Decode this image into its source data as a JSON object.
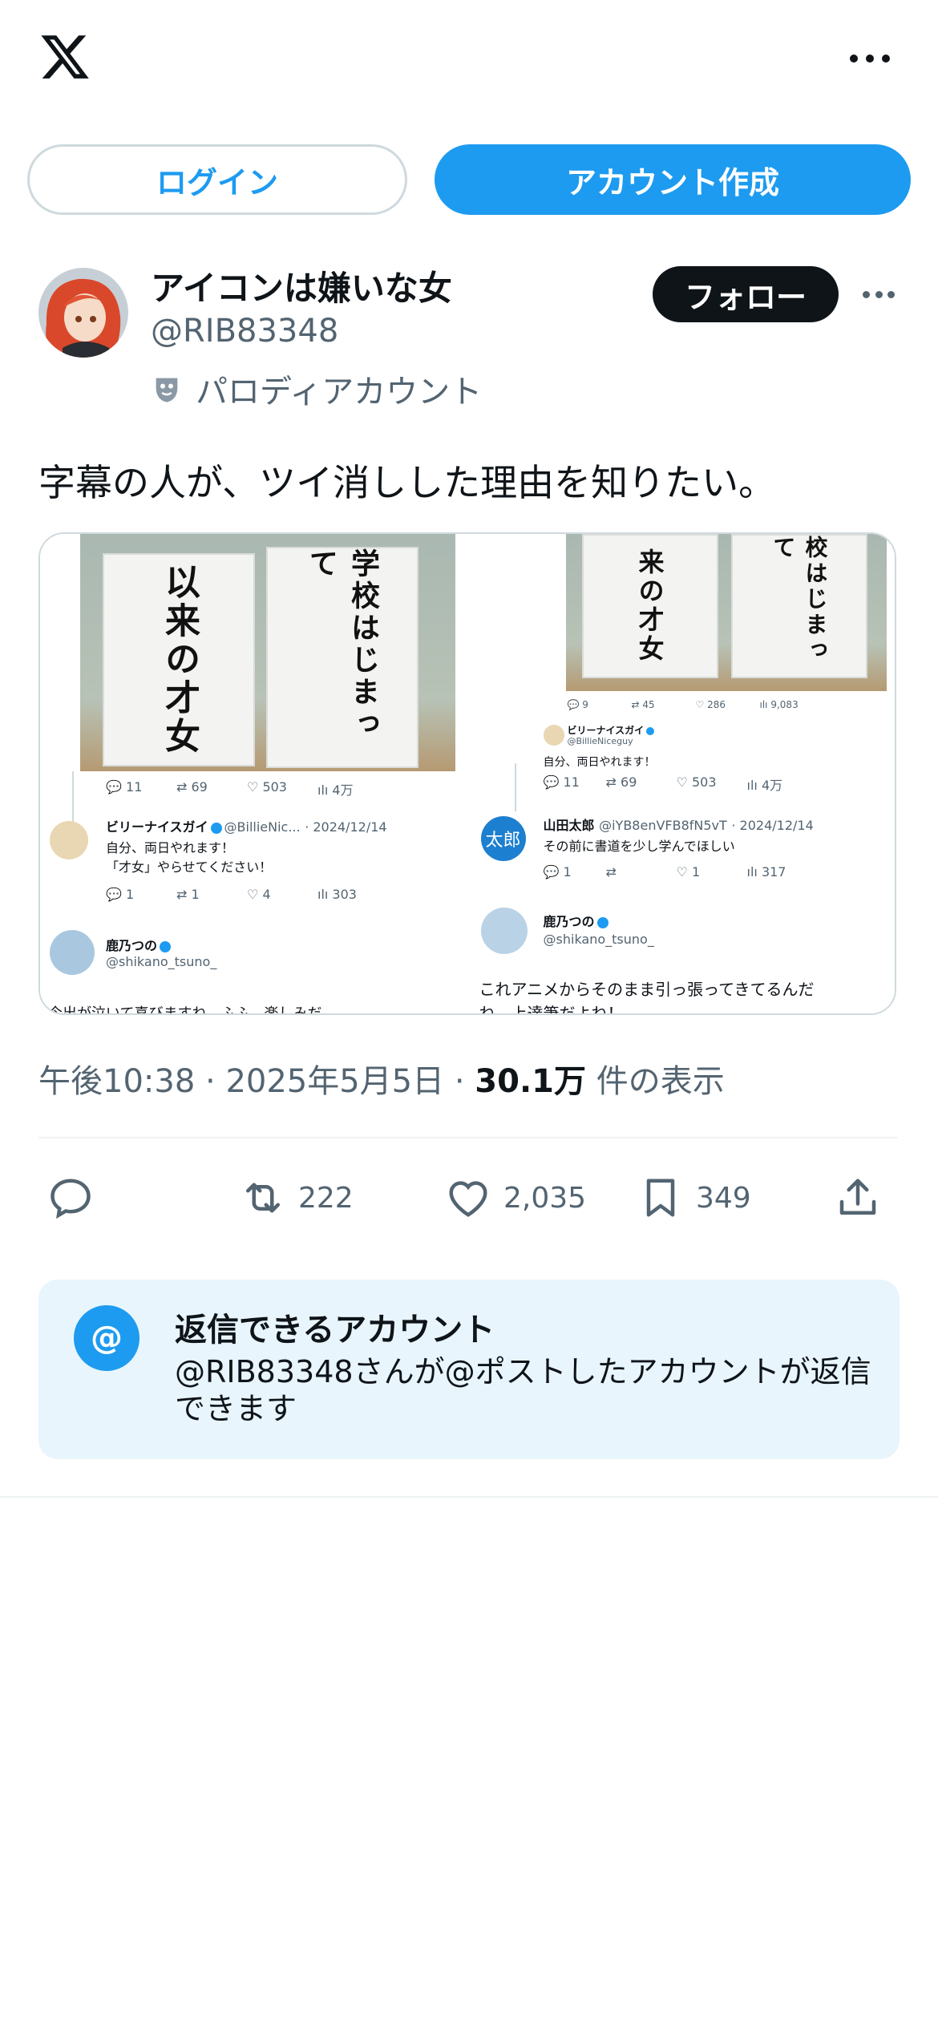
{
  "header": {
    "logo": "X",
    "more_icon": "more-horizontal-icon"
  },
  "auth": {
    "login_label": "ログイン",
    "signup_label": "アカウント作成"
  },
  "author": {
    "display_name": "アイコンは嫌いな女",
    "handle": "@RIB83348",
    "parody_label": "パロディアカウント",
    "follow_label": "フォロー"
  },
  "post": {
    "text": "字幕の人が、ツイ消しした理由を知りたい。",
    "time": "午後10:38",
    "date": "2025年5月5日",
    "views_count": "30.1万",
    "views_label": "件の表示",
    "separator": "·"
  },
  "media": {
    "left": {
      "board1": "以来の才女",
      "board2": "学校はじまって",
      "stats1": [
        "11",
        "69",
        "503",
        "4万"
      ],
      "reply_name": "ビリーナイスガイ",
      "reply_handle": "@BillieNic...",
      "reply_date": "· 2024/12/14",
      "reply_line1": "自分、両日やれます！",
      "reply_line2": "「才女」やらせてください！",
      "stats2": [
        "1",
        "1",
        "4",
        "303"
      ],
      "user_name": "鹿乃つの",
      "user_handle": "@shikano_tsuno_",
      "cut_text": "今出が泣いて喜びますね、ふふ、楽しみだ"
    },
    "right": {
      "board1": "来の才女",
      "board2": "校はじまって",
      "stats0": [
        "9",
        "45",
        "286",
        "9,083"
      ],
      "quoted_name": "ビリーナイスガイ",
      "quoted_handle": "@BillieNiceguy",
      "quoted_text": "自分、両日やれます！",
      "stats1": [
        "11",
        "69",
        "503",
        "4万"
      ],
      "reply_avatar": "太郎",
      "reply_name": "山田太郎",
      "reply_handle": "@iYB8enVFB8fN5vT",
      "reply_date": "· 2024/12/14",
      "reply_text": "その前に書道を少し学んでほしい",
      "stats2": [
        "1",
        "",
        "1",
        "317"
      ],
      "user_name": "鹿乃つの",
      "user_handle": "@shikano_tsuno_",
      "bottom_text": "これアニメからそのまま引っ張ってきてるんだ",
      "cut_text": "ね、上達筆だよね！"
    }
  },
  "actions": {
    "reply_icon": "reply-icon",
    "retweet_count": "222",
    "like_count": "2,035",
    "bookmark_count": "349",
    "share_icon": "share-icon"
  },
  "reply_restriction": {
    "icon_label": "@",
    "title": "返信できるアカウント",
    "body": "@RIB83348さんが@ポストしたアカウントが返信できます"
  },
  "colors": {
    "accent": "#1d9bf0",
    "text": "#0f1419",
    "muted": "#536471",
    "info_bg": "#e8f5fd"
  }
}
